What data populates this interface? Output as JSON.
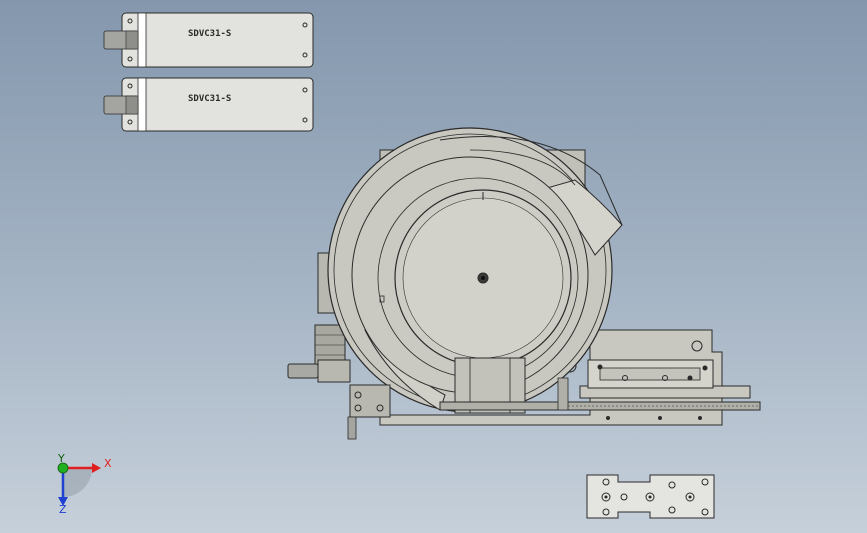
{
  "viewport": {
    "background_top": "#8497ad",
    "background_bottom": "#c6d0da"
  },
  "parts": {
    "controller_top": {
      "label": "SDVC31-S"
    },
    "controller_bottom": {
      "label": "SDVC31-S"
    }
  },
  "triad": {
    "x_label": "X",
    "y_label": "Y",
    "z_label": "Z",
    "x_color": "#e02020",
    "y_color": "#20b020",
    "z_color": "#2040d0"
  },
  "colors": {
    "part_fill": "#c8c8c0",
    "part_fill_dark": "#b4b4ac",
    "edge": "#2a2a2a",
    "plate_fill": "#e4e4e0"
  }
}
